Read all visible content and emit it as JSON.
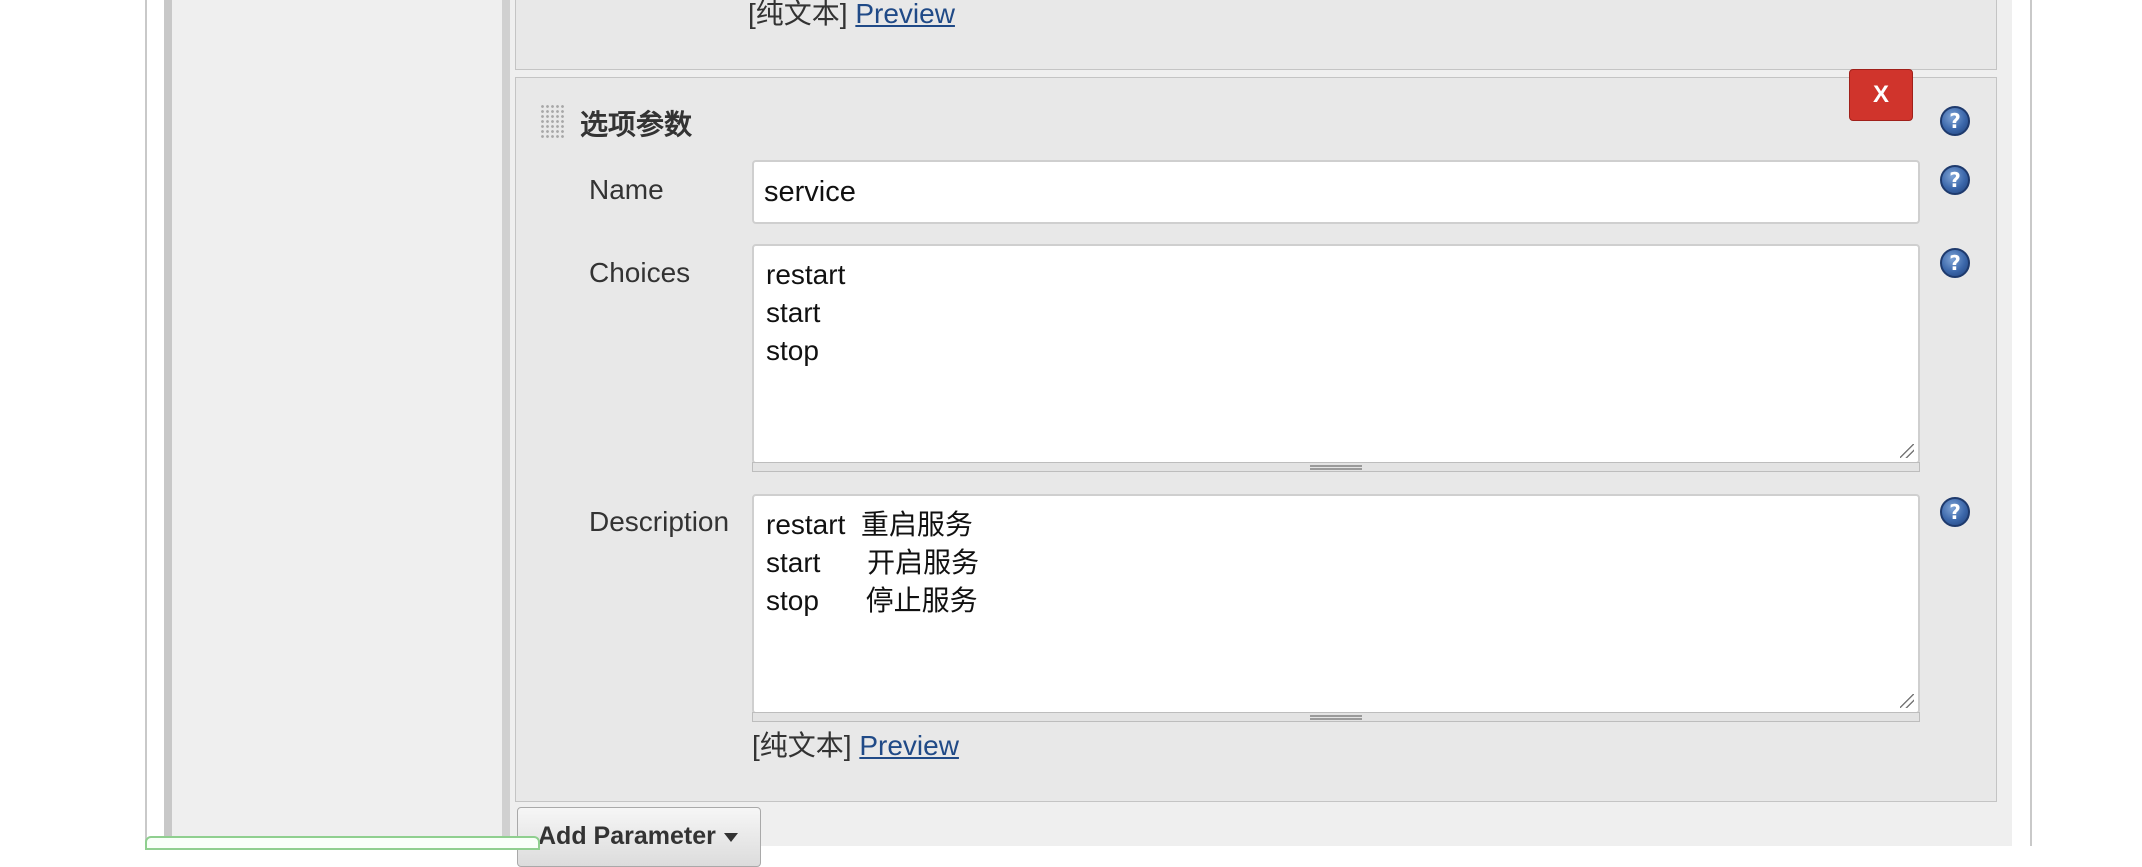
{
  "previous_block": {
    "plain_text_label": "[纯文本]",
    "preview_label": "Preview"
  },
  "choice_parameter": {
    "title": "选项参数",
    "delete_label": "X",
    "help_symbol": "?",
    "name": {
      "label": "Name",
      "value": "service"
    },
    "choices": {
      "label": "Choices",
      "value": "restart\nstart\nstop"
    },
    "description": {
      "label": "Description",
      "value": "restart  重启服务\nstart      开启服务\nstop      停止服务"
    },
    "plain_text_label": "[纯文本]",
    "preview_label": "Preview"
  },
  "toolbar": {
    "add_parameter_label": "Add Parameter"
  },
  "icons": {
    "help": "help-icon",
    "drag": "drag-handle-icon",
    "dropdown": "caret-down-icon"
  },
  "colors": {
    "delete_button": "#d0342c",
    "link": "#204a87",
    "help_icon": "#3b67aa"
  }
}
